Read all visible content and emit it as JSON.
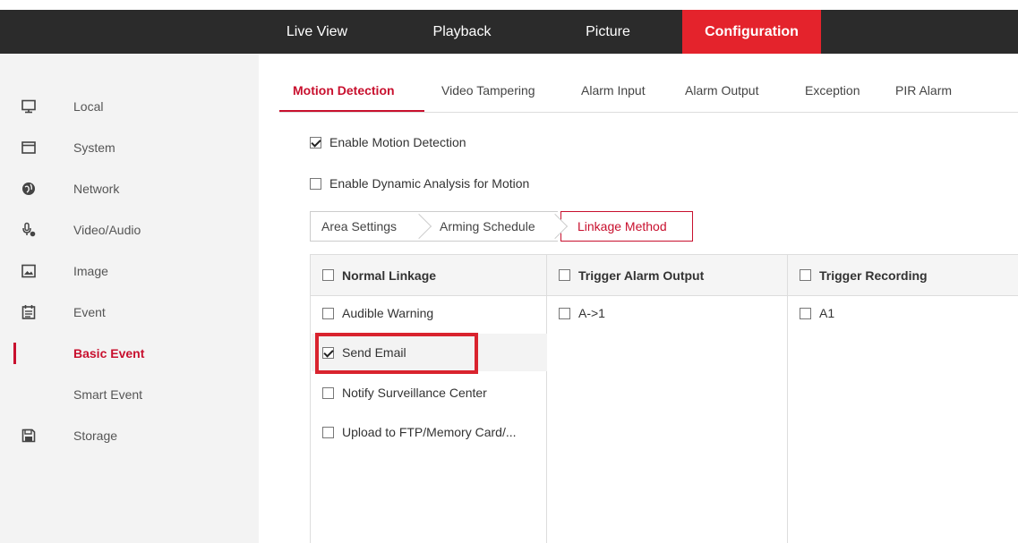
{
  "topnav": {
    "items": [
      {
        "label": "Live View"
      },
      {
        "label": "Playback"
      },
      {
        "label": "Picture"
      },
      {
        "label": "Configuration",
        "active": true
      }
    ]
  },
  "sidebar": {
    "items": [
      {
        "label": "Local",
        "icon": "monitor-icon"
      },
      {
        "label": "System",
        "icon": "window-icon"
      },
      {
        "label": "Network",
        "icon": "globe-icon"
      },
      {
        "label": "Video/Audio",
        "icon": "microphone-icon"
      },
      {
        "label": "Image",
        "icon": "image-icon"
      },
      {
        "label": "Event",
        "icon": "calendar-icon"
      },
      {
        "label": "Basic Event",
        "sub": true,
        "active": true
      },
      {
        "label": "Smart Event",
        "sub": true
      },
      {
        "label": "Storage",
        "icon": "floppy-icon"
      }
    ]
  },
  "subtabs": [
    {
      "label": "Motion Detection",
      "active": true
    },
    {
      "label": "Video Tampering"
    },
    {
      "label": "Alarm Input"
    },
    {
      "label": "Alarm Output"
    },
    {
      "label": "Exception"
    },
    {
      "label": "PIR Alarm"
    }
  ],
  "options": {
    "enable_motion": {
      "label": "Enable Motion Detection",
      "checked": true
    },
    "enable_dynamic": {
      "label": "Enable Dynamic Analysis for Motion",
      "checked": false
    }
  },
  "steps": [
    {
      "label": "Area Settings"
    },
    {
      "label": "Arming Schedule"
    },
    {
      "label": "Linkage Method",
      "active": true
    }
  ],
  "linkage": {
    "normal": {
      "header": "Normal Linkage",
      "items": [
        {
          "label": "Audible Warning",
          "checked": false
        },
        {
          "label": "Send Email",
          "checked": true
        },
        {
          "label": "Notify Surveillance Center",
          "checked": false
        },
        {
          "label": "Upload to FTP/Memory Card/...",
          "checked": false
        }
      ]
    },
    "alarm_output": {
      "header": "Trigger Alarm Output",
      "items": [
        {
          "label": "A->1",
          "checked": false
        }
      ]
    },
    "recording": {
      "header": "Trigger Recording",
      "items": [
        {
          "label": "A1",
          "checked": false
        }
      ]
    }
  },
  "colors": {
    "accent": "#e4232c",
    "topbar": "#2b2b2b",
    "sidebar": "#f3f3f3",
    "highlight": "#d9232e"
  }
}
